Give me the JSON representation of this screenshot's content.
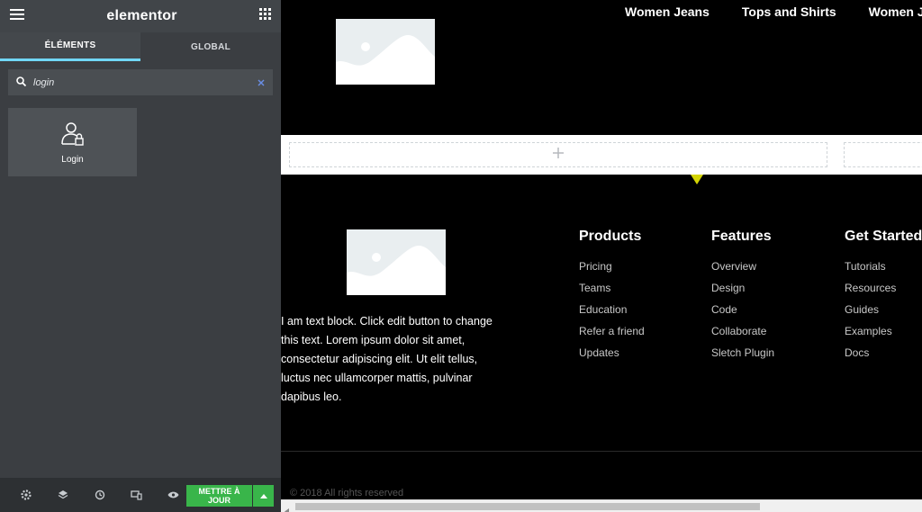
{
  "editor": {
    "logo": "elementor",
    "tabs": [
      {
        "label": "ÉLÉMENTS"
      },
      {
        "label": "GLOBAL"
      }
    ],
    "search": {
      "value": "login",
      "placeholder": ""
    },
    "widgets": [
      {
        "label": "Login",
        "icon": "login-icon"
      }
    ],
    "footer": {
      "update_label": "METTRE À JOUR",
      "accent": "#39b54a"
    }
  },
  "canvas": {
    "nav": [
      "Women Jeans",
      "Tops and Shirts",
      "Women Jack"
    ],
    "text_block": "I am text block. Click edit button to change this text. Lorem ipsum dolor sit amet, consectetur adipiscing elit. Ut elit tellus, luctus nec ullamcorper mattis, pulvinar dapibus leo.",
    "columns": [
      {
        "title": "Products",
        "links": [
          "Pricing",
          "Teams",
          "Education",
          "Refer a friend",
          "Updates"
        ]
      },
      {
        "title": "Features",
        "links": [
          "Overview",
          "Design",
          "Code",
          "Collaborate",
          "Sletch Plugin"
        ]
      },
      {
        "title": "Get Started",
        "links": [
          "Tutorials",
          "Resources",
          "Guides",
          "Examples",
          "Docs"
        ]
      }
    ],
    "copyright": "© 2018 All rights reserved"
  }
}
